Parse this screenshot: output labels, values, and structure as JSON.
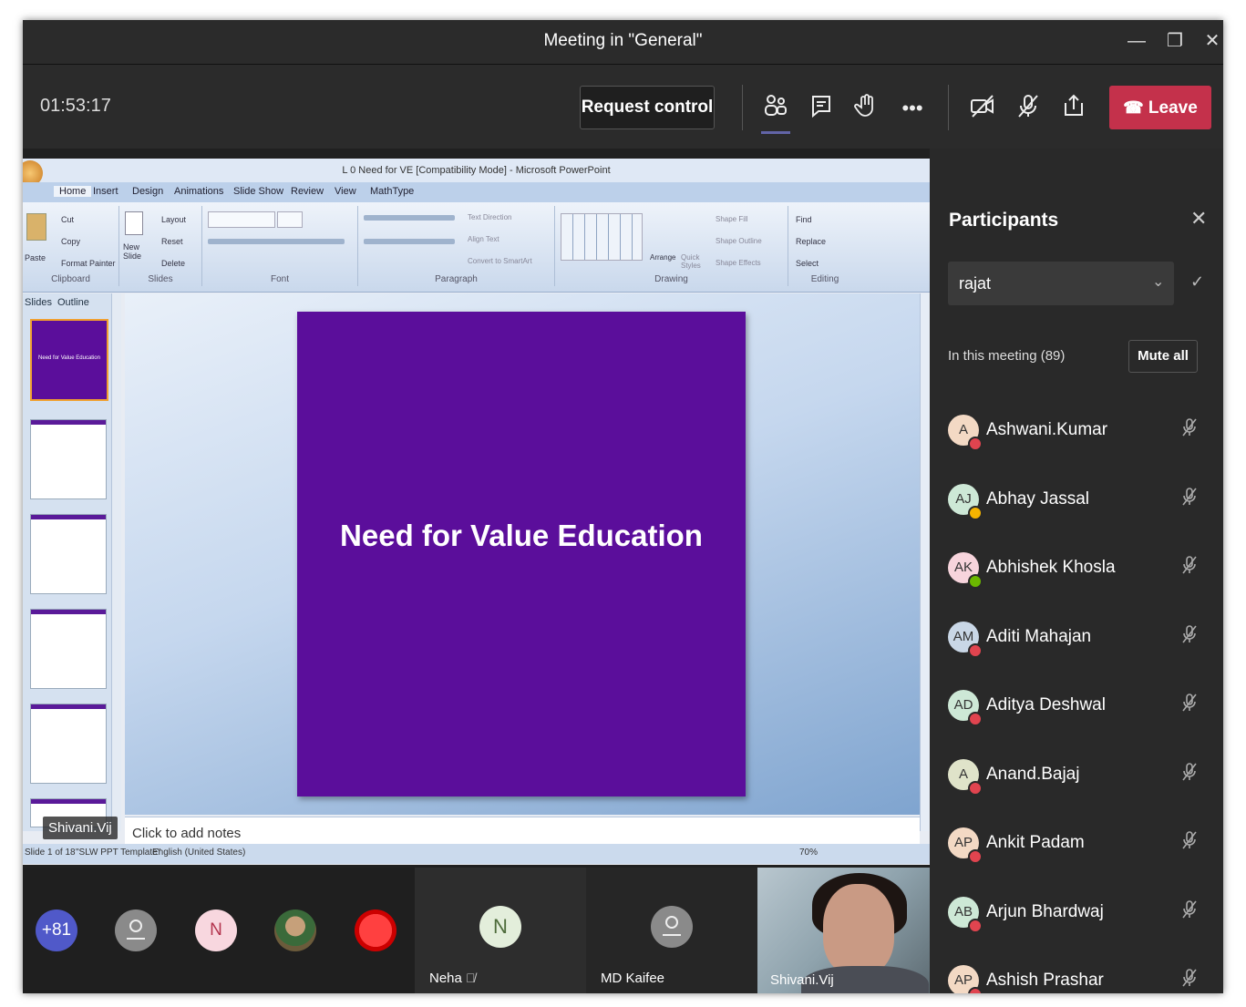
{
  "window": {
    "title": "Meeting in \"General\"",
    "minimize_icon": "minimize-icon",
    "restore_icon": "restore-icon",
    "close_icon": "close-icon"
  },
  "toolbar": {
    "timer": "01:53:17",
    "request_control": "Request control",
    "icons": [
      "participants-icon",
      "chat-icon",
      "raise-hand-icon",
      "more-options-icon",
      "camera-off-icon",
      "mic-off-icon",
      "share-tray-icon"
    ],
    "leave_label": "Leave",
    "leave_color": "#c4314b"
  },
  "share": {
    "window_title": "L 0 Need for VE [Compatibility Mode] - Microsoft PowerPoint",
    "ribbon_tabs": [
      "Home",
      "Insert",
      "Design",
      "Animations",
      "Slide Show",
      "Review",
      "View",
      "MathType"
    ],
    "groups": [
      "Clipboard",
      "Slides",
      "Font",
      "Paragraph",
      "Drawing",
      "Editing"
    ],
    "clipboard_items": [
      "Cut",
      "Copy",
      "Format Painter"
    ],
    "slides_items": [
      "Layout",
      "Reset",
      "Delete"
    ],
    "paste": "Paste",
    "new_slide": "New Slide",
    "paragraph_items": [
      "Text Direction",
      "Align Text",
      "Convert to SmartArt"
    ],
    "drawing_items": [
      "Arrange",
      "Quick Styles",
      "Shape Fill",
      "Shape Outline",
      "Shape Effects"
    ],
    "editing_items": [
      "Find",
      "Replace",
      "Select"
    ],
    "panel_tabs": [
      "Slides",
      "Outline"
    ],
    "slide_title": "Need for Value Education",
    "slide_color": "#5b0e9b",
    "thumb1_text": "Need for Value Education",
    "notes_placeholder": "Click to add notes",
    "status": [
      "Slide 1 of 18",
      "\"SLW PPT Template\"",
      "English (United States)"
    ],
    "zoom": "70%",
    "presenter_label": "Shivani.Vij"
  },
  "tiles": {
    "overflow_count": "+81",
    "n_initial": "N",
    "neha_name": "Neha",
    "neha_initial": "N",
    "kaifee_name": "MD Kaifee",
    "shivani_name": "Shivani.Vij"
  },
  "panel": {
    "title": "Participants",
    "search_value": "rajat",
    "section": "In this meeting (89)",
    "mute_all": "Mute all",
    "people": [
      {
        "initials": "A",
        "name": "Ashwani.Kumar",
        "bg": "#f3d9c4",
        "status": "#e0444f"
      },
      {
        "initials": "AJ",
        "name": "Abhay Jassal",
        "bg": "#cde8d6",
        "status": "#f5b400"
      },
      {
        "initials": "AK",
        "name": "Abhishek Khosla",
        "bg": "#f7d4dc",
        "status": "#6bb700"
      },
      {
        "initials": "AM",
        "name": "Aditi Mahajan",
        "bg": "#c9d7e6",
        "status": "#e0444f"
      },
      {
        "initials": "AD",
        "name": "Aditya Deshwal",
        "bg": "#cde8d6",
        "status": "#e0444f"
      },
      {
        "initials": "A",
        "name": "Anand.Bajaj",
        "bg": "#dfe3c9",
        "status": "#e0444f"
      },
      {
        "initials": "AP",
        "name": "Ankit Padam",
        "bg": "#f3d9c4",
        "status": "#e0444f"
      },
      {
        "initials": "AB",
        "name": "Arjun Bhardwaj",
        "bg": "#cde8d6",
        "status": "#e0444f"
      },
      {
        "initials": "AP",
        "name": "Ashish Prashar",
        "bg": "#f3d9c4",
        "status": "#e0444f"
      }
    ]
  }
}
